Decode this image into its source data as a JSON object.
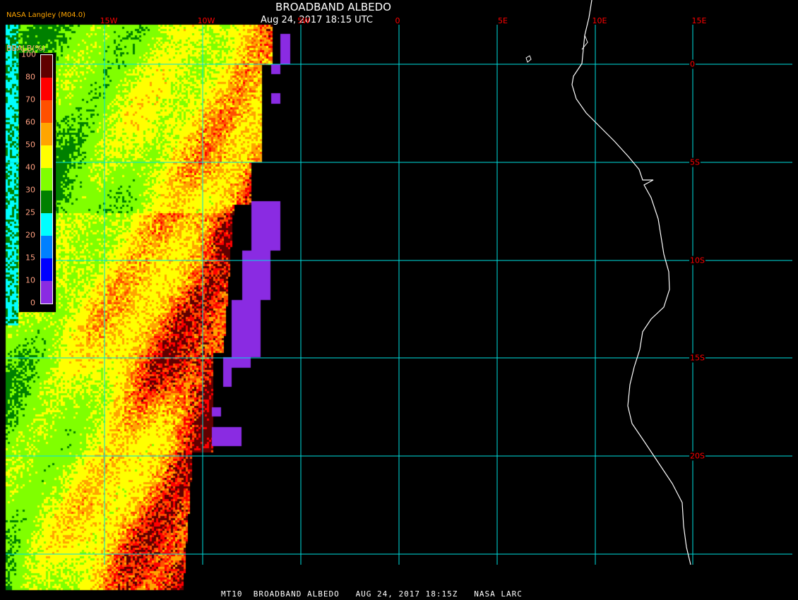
{
  "header": {
    "title": "BROADBAND ALBEDO",
    "subtitle": "Aug 24, 2017 18:15 UTC",
    "credit": "NASA Langley (M04.0)"
  },
  "grid": {
    "longitude_labels": [
      "15W",
      "10W",
      "5W",
      "0",
      "5E",
      "10E",
      "15E"
    ],
    "latitude_labels": [
      "0",
      "5S",
      "10S",
      "15S",
      "20S"
    ]
  },
  "legend": {
    "title": "BBALB(%)",
    "ticks": [
      "0",
      "10",
      "15",
      "20",
      "25",
      "30",
      "40",
      "50",
      "60",
      "70",
      "80",
      "100"
    ],
    "colors": [
      "#8a2be2",
      "#0000ff",
      "#0080ff",
      "#00ffff",
      "#008000",
      "#80ff00",
      "#ffff00",
      "#ffa500",
      "#ff5000",
      "#ff0000",
      "#600000"
    ]
  },
  "footer": "MT10  BROADBAND ALBEDO   AUG 24, 2017 18:15Z   NASA LARC"
}
